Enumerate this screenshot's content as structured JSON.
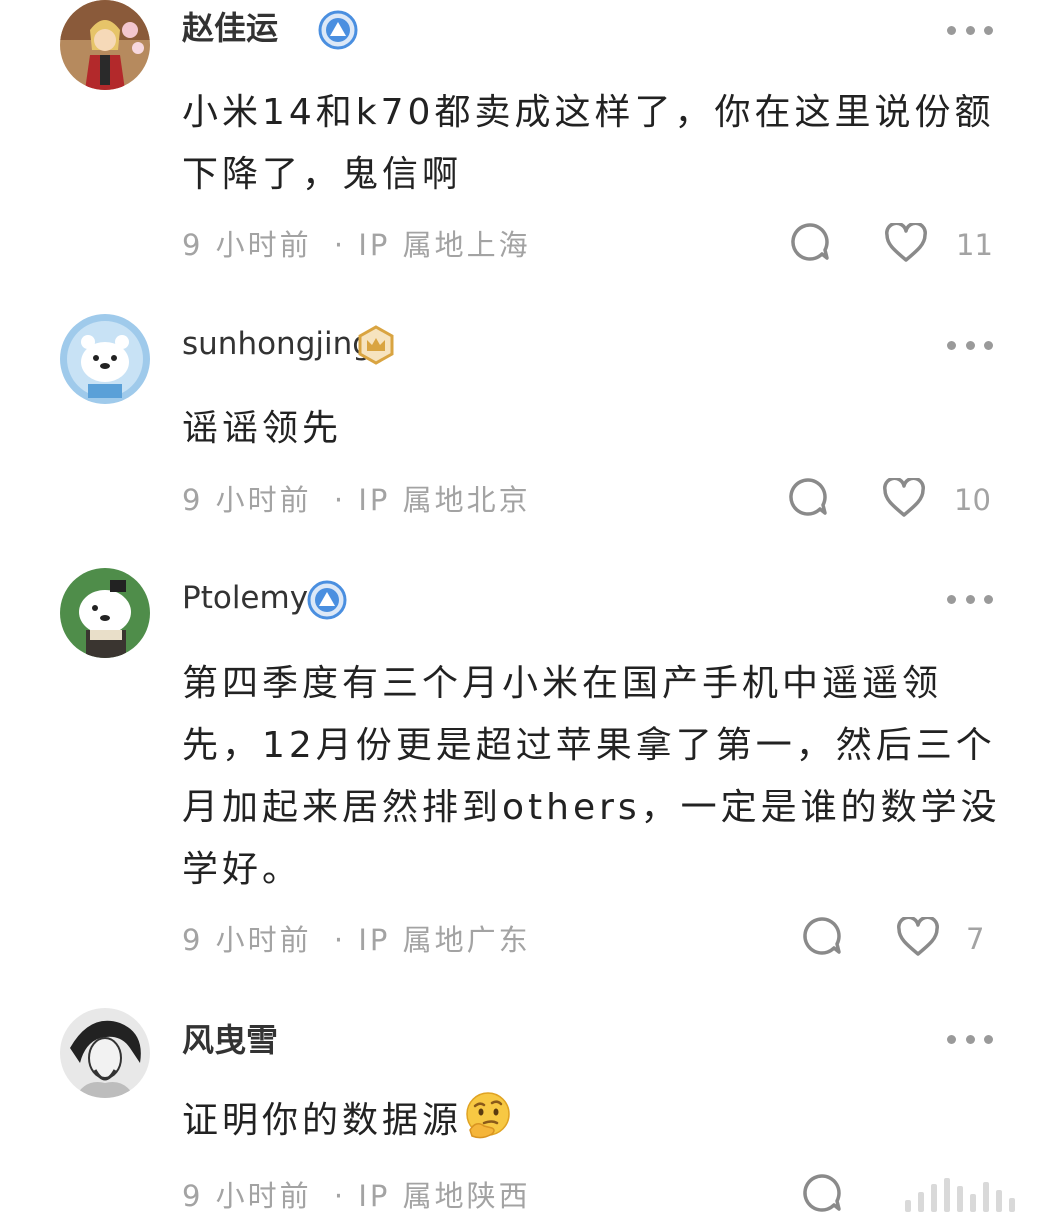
{
  "comments": [
    {
      "username": "赵佳运",
      "badge": "blue-triangle-badge",
      "text": "小米14和k70都卖成这样了，你在这里说份额下降了，鬼信啊",
      "time": "9 小时前",
      "location": "· IP 属地上海",
      "likes": "11"
    },
    {
      "username": "sunhongjing",
      "badge": "gold-crown-badge",
      "text": "谣谣领先",
      "time": "9 小时前",
      "location": "· IP 属地北京",
      "likes": "10"
    },
    {
      "username": "Ptolemy",
      "badge": "blue-triangle-badge",
      "text": "第四季度有三个月小米在国产手机中遥遥领先，12月份更是超过苹果拿了第一，然后三个月加起来居然排到others，一定是谁的数学没学好。",
      "time": "9 小时前",
      "location": "· IP 属地广东",
      "likes": "7"
    },
    {
      "username": "风曳雪",
      "badge": "",
      "text": "证明你的数据源",
      "emoji": "thinking-face-emoji",
      "time": "9 小时前",
      "location": "· IP 属地陕西",
      "likes": ""
    }
  ],
  "colors": {
    "meta_gray": "#a3a3a3",
    "badge_blue": "#4a8fe0",
    "badge_gold": "#d9a441"
  }
}
